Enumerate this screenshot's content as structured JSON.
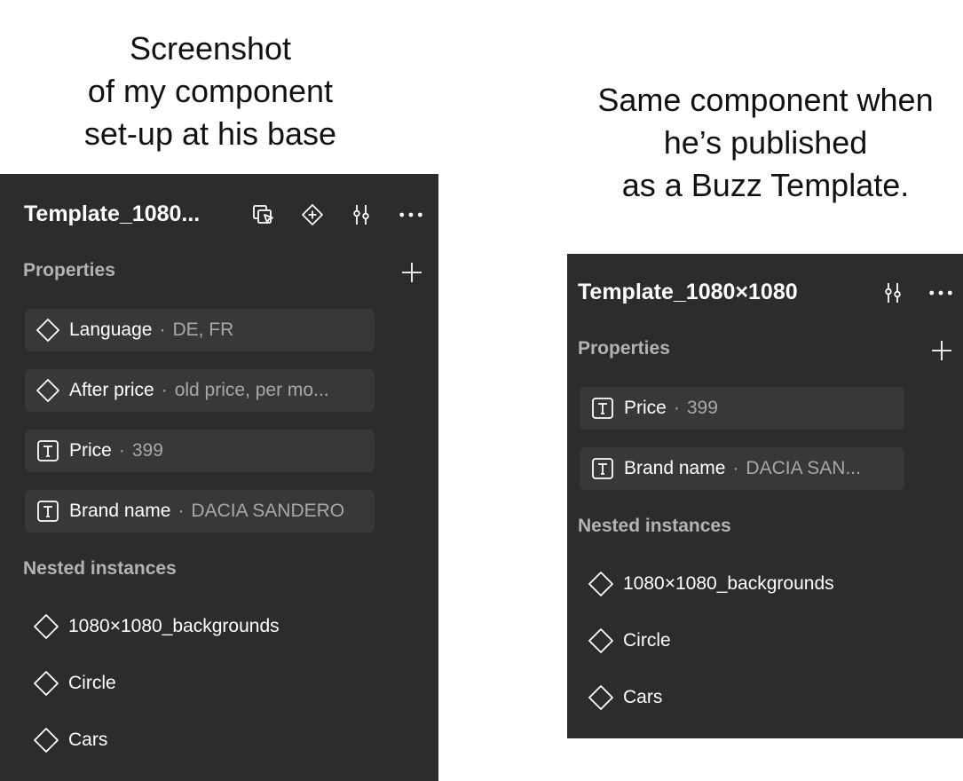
{
  "captions": {
    "left": [
      "Screenshot",
      "of my component",
      "set-up at his base"
    ],
    "right": [
      "Same component when",
      "he’s published",
      "as a Buzz Template."
    ]
  },
  "base_panel": {
    "title": "Template_1080...",
    "header_icons": [
      "select-matching-icon",
      "component-icon",
      "adjust-icon",
      "more-icon"
    ],
    "properties_label": "Properties",
    "properties": [
      {
        "icon": "variant-diamond-icon",
        "name": "Language",
        "sep": "·",
        "value": "DE, FR"
      },
      {
        "icon": "variant-diamond-icon",
        "name": "After price",
        "sep": "·",
        "value": "old price, per mo..."
      },
      {
        "icon": "text-property-icon",
        "name": "Price",
        "sep": "·",
        "value": "399"
      },
      {
        "icon": "text-property-icon",
        "name": "Brand name",
        "sep": "·",
        "value": "DACIA SANDERO"
      }
    ],
    "nested_label": "Nested instances",
    "nested": [
      {
        "icon": "instance-diamond-icon",
        "name": "1080×1080_backgrounds"
      },
      {
        "icon": "instance-diamond-icon",
        "name": "Circle"
      },
      {
        "icon": "instance-diamond-icon",
        "name": "Cars"
      }
    ]
  },
  "published_panel": {
    "title": "Template_1080×1080",
    "header_icons": [
      "adjust-icon",
      "more-icon"
    ],
    "properties_label": "Properties",
    "properties": [
      {
        "icon": "text-property-icon",
        "name": "Price",
        "sep": "·",
        "value": "399"
      },
      {
        "icon": "text-property-icon",
        "name": "Brand name",
        "sep": "·",
        "value": "DACIA SAN..."
      }
    ],
    "nested_label": "Nested instances",
    "nested": [
      {
        "icon": "instance-diamond-icon",
        "name": "1080×1080_backgrounds"
      },
      {
        "icon": "instance-diamond-icon",
        "name": "Circle"
      },
      {
        "icon": "instance-diamond-icon",
        "name": "Cars"
      }
    ]
  }
}
